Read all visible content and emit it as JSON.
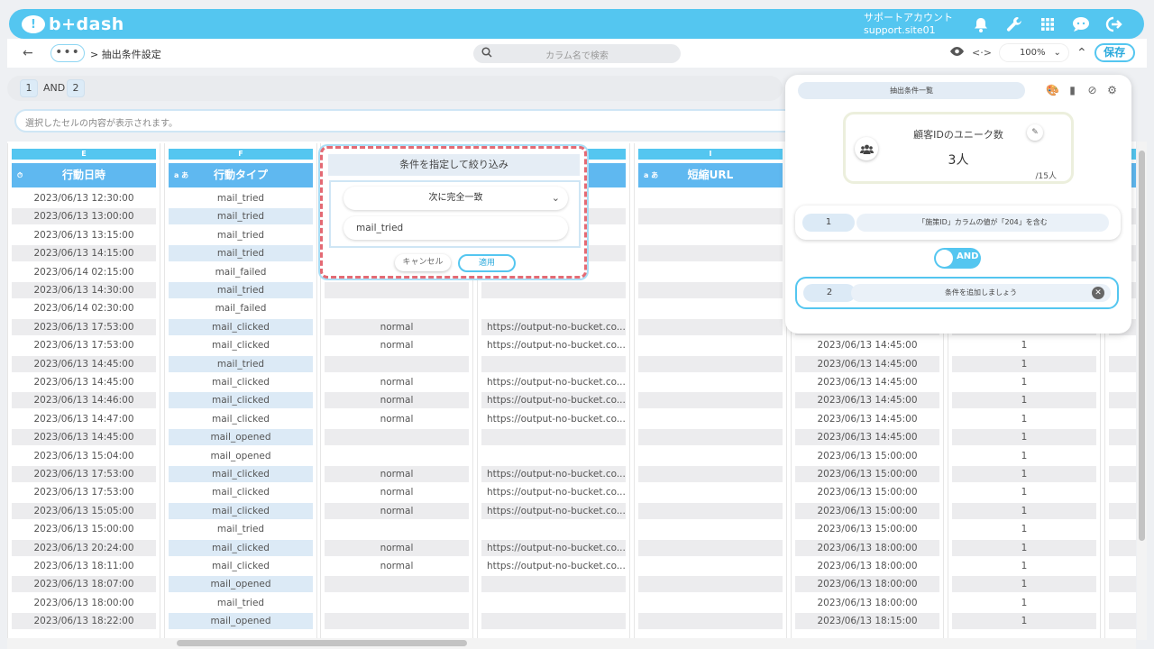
{
  "app": {
    "logo_text": "b+dash",
    "account_name": "サポートアカウント",
    "account_site": "support.site01"
  },
  "toolbar": {
    "dots": "•••",
    "breadcrumb": "> 抽出条件設定",
    "search_placeholder": "カラム名で検索",
    "zoom": "100%",
    "save_label": "保存"
  },
  "conditions": {
    "chip1": "1",
    "and_label": "AND",
    "chip2": "2"
  },
  "cellbar_placeholder": "選択したセルの内容が表示されます。",
  "columns": [
    {
      "letter": "E",
      "header": "行動日時",
      "type_icon": "⏱"
    },
    {
      "letter": "F",
      "header": "行動タイプ",
      "type_icon": "a あ"
    },
    {
      "letter": "",
      "header": "",
      "type_icon": ""
    },
    {
      "letter": "",
      "header": "",
      "type_icon": ""
    },
    {
      "letter": "I",
      "header": "短縮URL",
      "type_icon": "a あ"
    },
    {
      "letter": "",
      "header": "",
      "type_icon": ""
    },
    {
      "letter": "",
      "header": "",
      "type_icon": ""
    }
  ],
  "rows": {
    "datetime": [
      "2023/06/13 12:30:00",
      "2023/06/13 13:00:00",
      "2023/06/13 13:15:00",
      "2023/06/13 14:15:00",
      "2023/06/14 02:15:00",
      "2023/06/13 14:30:00",
      "2023/06/14 02:30:00",
      "2023/06/13 17:53:00",
      "2023/06/13 17:53:00",
      "2023/06/13 14:45:00",
      "2023/06/13 14:45:00",
      "2023/06/13 14:46:00",
      "2023/06/13 14:47:00",
      "2023/06/13 14:45:00",
      "2023/06/13 15:04:00",
      "2023/06/13 17:53:00",
      "2023/06/13 17:53:00",
      "2023/06/13 15:05:00",
      "2023/06/13 15:00:00",
      "2023/06/13 20:24:00",
      "2023/06/13 18:11:00",
      "2023/06/13 18:07:00",
      "2023/06/13 18:00:00",
      "2023/06/13 18:22:00"
    ],
    "action": [
      "mail_tried",
      "mail_tried",
      "mail_tried",
      "mail_tried",
      "mail_failed",
      "mail_tried",
      "mail_failed",
      "mail_clicked",
      "mail_clicked",
      "mail_tried",
      "mail_clicked",
      "mail_clicked",
      "mail_clicked",
      "mail_opened",
      "mail_opened",
      "mail_clicked",
      "mail_clicked",
      "mail_clicked",
      "mail_tried",
      "mail_clicked",
      "mail_clicked",
      "mail_opened",
      "mail_tried",
      "mail_opened"
    ],
    "g": [
      "",
      "",
      "",
      "",
      "",
      "",
      "",
      "normal",
      "normal",
      "",
      "normal",
      "normal",
      "normal",
      "",
      "",
      "normal",
      "normal",
      "normal",
      "",
      "normal",
      "normal",
      "",
      "",
      ""
    ],
    "h": [
      "",
      "",
      "",
      "",
      "",
      "",
      "",
      "https://output-no-bucket.co...",
      "https://output-no-bucket.co...",
      "",
      "https://output-no-bucket.co...",
      "https://output-no-bucket.co...",
      "https://output-no-bucket.co...",
      "",
      "",
      "https://output-no-bucket.co...",
      "https://output-no-bucket.co...",
      "https://output-no-bucket.co...",
      "",
      "https://output-no-bucket.co...",
      "https://output-no-bucket.co...",
      "",
      "",
      ""
    ],
    "k": [
      "",
      "",
      "",
      "",
      "",
      "",
      "",
      "",
      "2023/06/13 14:45:00",
      "2023/06/13 14:45:00",
      "2023/06/13 14:45:00",
      "2023/06/13 14:45:00",
      "2023/06/13 14:45:00",
      "2023/06/13 14:45:00",
      "2023/06/13 15:00:00",
      "2023/06/13 15:00:00",
      "2023/06/13 15:00:00",
      "2023/06/13 15:00:00",
      "2023/06/13 15:00:00",
      "2023/06/13 18:00:00",
      "2023/06/13 18:00:00",
      "2023/06/13 18:00:00",
      "2023/06/13 18:00:00",
      "2023/06/13 18:15:00"
    ],
    "l": [
      "",
      "",
      "",
      "",
      "",
      "",
      "",
      "",
      "1",
      "1",
      "1",
      "1",
      "1",
      "1",
      "1",
      "1",
      "1",
      "1",
      "1",
      "1",
      "1",
      "1",
      "1",
      "1"
    ]
  },
  "popup": {
    "title": "条件を指定して絞り込み",
    "match_mode": "次に完全一致",
    "value": "mail_tried",
    "cancel": "キャンセル",
    "apply": "適用"
  },
  "panel": {
    "title": "抽出条件一覧",
    "unique_label": "顧客IDのユニーク数",
    "unique_value": "3人",
    "unique_total": "/15人",
    "cond1_num": "1",
    "cond1_text": "「施策ID」カラムの値が「204」を含む",
    "and_toggle": "AND",
    "cond2_num": "2",
    "cond2_text": "条件を追加しましょう"
  }
}
